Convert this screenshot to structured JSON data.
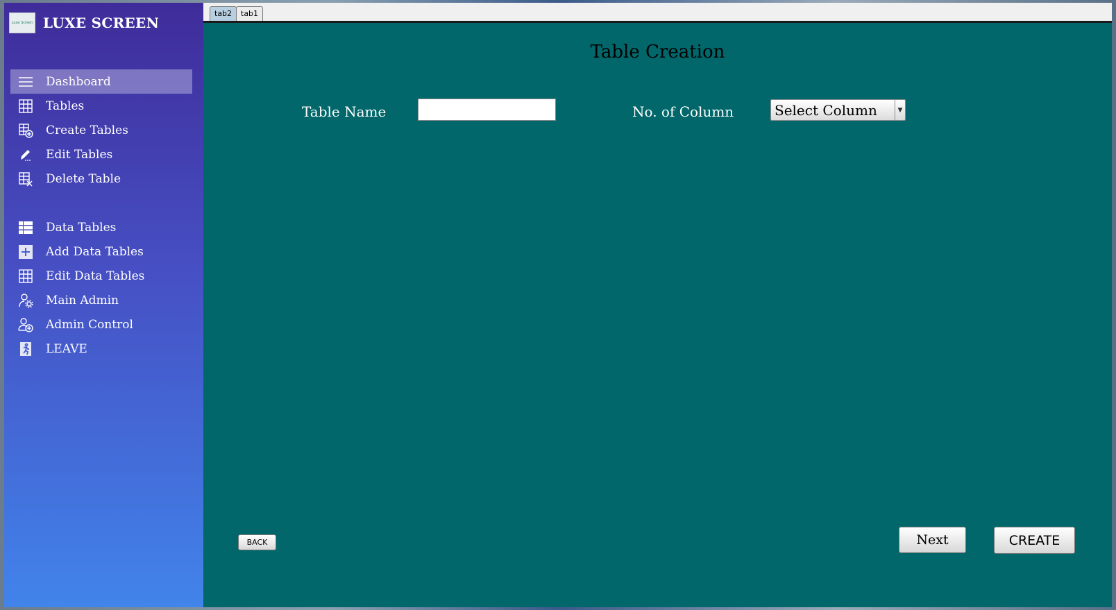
{
  "brand": {
    "title": "LUXE SCREEN",
    "logo_text": "Luxe Screen"
  },
  "sidebar": {
    "items": [
      {
        "label": "Dashboard",
        "icon": "hamburger-icon",
        "active": true
      },
      {
        "label": "Tables",
        "icon": "table-grid-icon"
      },
      {
        "label": "Create Tables",
        "icon": "table-add-icon"
      },
      {
        "label": "Edit Tables",
        "icon": "pencil-icon"
      },
      {
        "label": "Delete Table",
        "icon": "table-delete-icon"
      },
      {
        "label": "Data Tables",
        "icon": "data-table-icon"
      },
      {
        "label": "Add Data Tables",
        "icon": "plus-square-icon"
      },
      {
        "label": "Edit Data Tables",
        "icon": "table-grid-icon"
      },
      {
        "label": "Main Admin",
        "icon": "admin-gear-icon"
      },
      {
        "label": "Admin Control",
        "icon": "admin-add-icon"
      },
      {
        "label": "LEAVE",
        "icon": "exit-run-icon"
      }
    ]
  },
  "tabs": [
    {
      "label": "tab2",
      "active": true
    },
    {
      "label": "tab1",
      "active": false
    }
  ],
  "form": {
    "title": "Table Creation",
    "table_name_label": "Table Name",
    "table_name_value": "",
    "columns_label": "No. of Column",
    "columns_selected": "Select Column"
  },
  "buttons": {
    "back": "BACK",
    "next": "Next",
    "create": "CREATE"
  },
  "colors": {
    "main_bg": "#01676a",
    "sidebar_top": "#3f2c9a",
    "sidebar_bottom": "#4184ea"
  }
}
